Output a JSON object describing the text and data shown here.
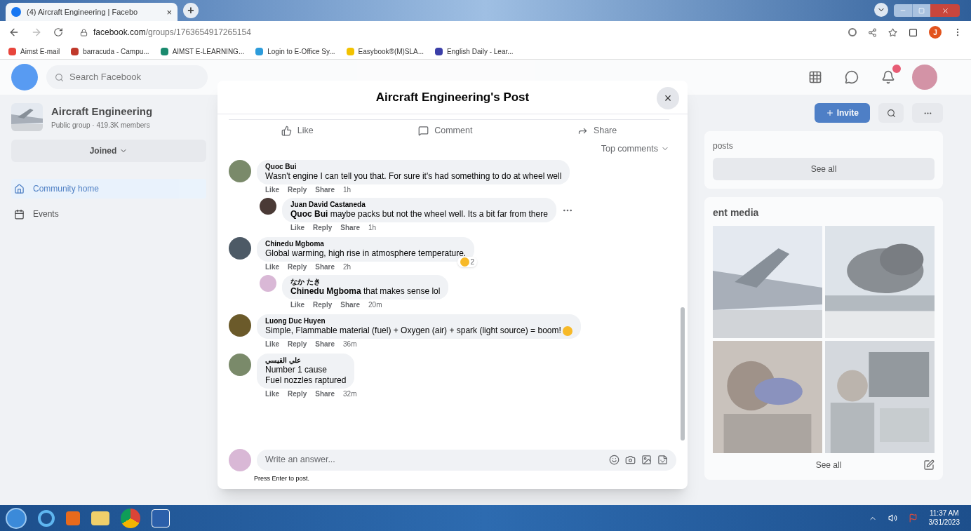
{
  "browser": {
    "tab": {
      "title": "(4) Aircraft Engineering | Facebo",
      "close": "×"
    },
    "new_tab": "+",
    "url": {
      "host": "facebook.com",
      "path": "/groups/1763654917265154"
    },
    "profile_initial": "J",
    "bookmarks": [
      {
        "label": "Aimst E-mail",
        "color": "#e8453c"
      },
      {
        "label": "barracuda - Campu...",
        "color": "#c0392b"
      },
      {
        "label": "AIMST E-LEARNING...",
        "color": "#1a8a6e"
      },
      {
        "label": "Login to E-Office Sy...",
        "color": "#2d9cdb"
      },
      {
        "label": "Easybook®(M)SLA...",
        "color": "#f2c200"
      },
      {
        "label": "English Daily - Lear...",
        "color": "#3b3fa8"
      }
    ]
  },
  "facebook": {
    "search": {
      "placeholder": "Search Facebook"
    },
    "group": {
      "name": "Aircraft Engineering",
      "meta": "Public group · 419.3K members",
      "joined_button": "Joined"
    },
    "sidebar": [
      {
        "label": "Community home",
        "selected": true
      },
      {
        "label": "Events",
        "selected": false
      }
    ],
    "invite_button": "Invite",
    "posts_card": {
      "title": "posts",
      "button": "See all"
    },
    "media_card": {
      "title": "ent media",
      "button": "See all"
    }
  },
  "post_dialog": {
    "title": "Aircraft Engineering's Post",
    "close": "×",
    "actions": [
      {
        "kind": "like",
        "label": "Like"
      },
      {
        "kind": "comment",
        "label": "Comment"
      },
      {
        "kind": "share",
        "label": "Share"
      }
    ],
    "sort": "Top comments",
    "comments": [
      {
        "author": "Quoc Bui",
        "text": "Wasn't engine I can tell you that. For sure it's had something to do at wheel well",
        "actions": [
          "Like",
          "Reply",
          "Share"
        ],
        "time": "1h",
        "replies": [
          {
            "author": "Juan David Castaneda",
            "text": "**Quoc Bui** maybe packs but not the wheel well. Its a bit far from there",
            "actions": [
              "Like",
              "Reply",
              "Share"
            ],
            "time": "1h",
            "more": true
          }
        ]
      },
      {
        "author": "Chinedu Mgboma",
        "text": "Global warming, high rise in atmosphere temperature.",
        "actions": [
          "Like",
          "Reply",
          "Share"
        ],
        "time": "2h",
        "reaction_count": "2",
        "replies": [
          {
            "author": "なか たき",
            "text": "**Chinedu Mgboma** that makes sense lol",
            "actions": [
              "Like",
              "Reply",
              "Share"
            ],
            "time": "20m",
            "more": false
          }
        ]
      },
      {
        "author": "Luong Duc Huyen",
        "text": "Simple, Flammable material (fuel) + Oxygen (air) + spark (light source) = boom!",
        "emoji": true,
        "actions": [
          "Like",
          "Reply",
          "Share"
        ],
        "time": "36m"
      },
      {
        "author": "علي القيسي",
        "text": "Number 1 cause\nFuel nozzles raptured",
        "actions": [
          "Like",
          "Reply",
          "Share"
        ],
        "time": "32m"
      }
    ],
    "composer": {
      "placeholder": "Write an answer...",
      "hint": "Press Enter to post."
    }
  },
  "taskbar": {
    "time": "11:37 AM",
    "date": "3/31/2023"
  }
}
